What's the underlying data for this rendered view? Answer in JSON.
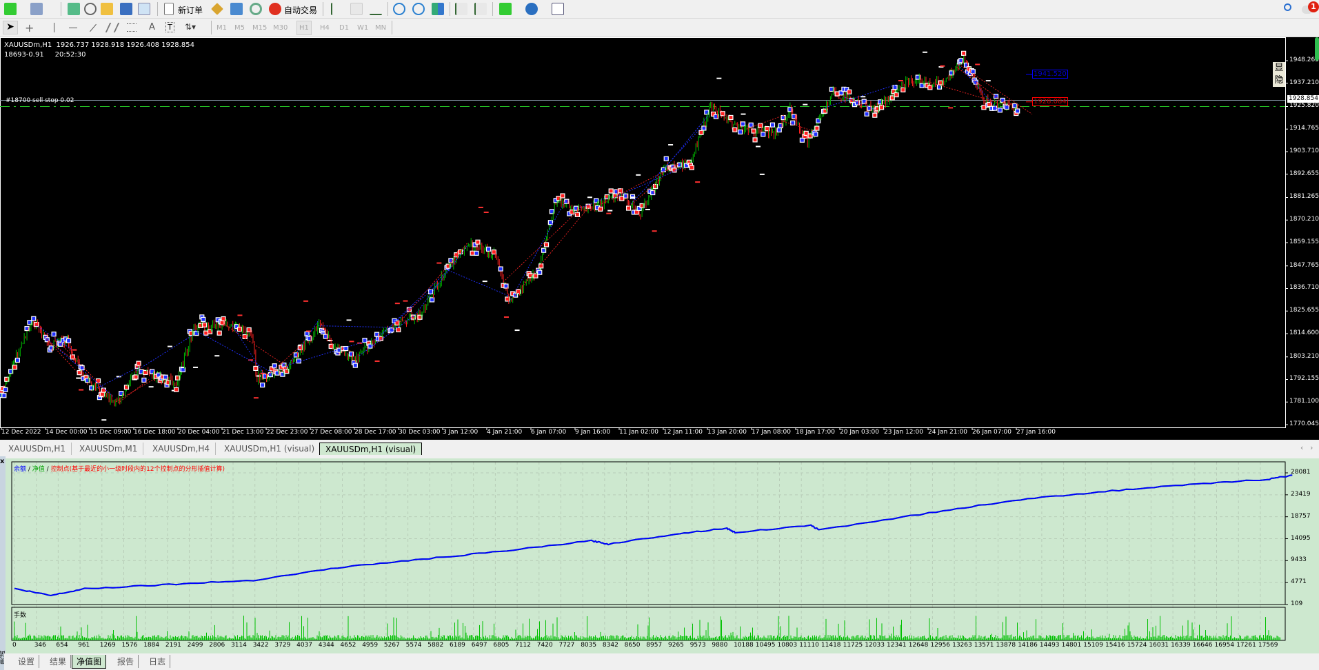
{
  "toolbar": {
    "new_order_label": "新订单",
    "auto_trading_label": "自动交易",
    "timeframes": [
      "M1",
      "M5",
      "M15",
      "M30",
      "H1",
      "H4",
      "D1",
      "W1",
      "MN"
    ],
    "active_timeframe": "H1",
    "notification_count": "1"
  },
  "chart": {
    "header_line": "XAUUSDm,H1  1926.737 1928.918 1926.408 1928.854",
    "sub_line": "18693-0.91     20:52:30",
    "order_label": "#18700 sell stop 0.02",
    "current_price": "1928.854",
    "blue_level_label": "1941.520",
    "red_level_label": "1928.084",
    "show_button": "显",
    "hide_button": "隐",
    "price_axis": [
      "1948.265",
      "1937.210",
      "1925.820",
      "1914.765",
      "1903.710",
      "1892.655",
      "1881.265",
      "1870.210",
      "1859.155",
      "1847.765",
      "1836.710",
      "1825.655",
      "1814.600",
      "1803.210",
      "1792.155",
      "1781.100",
      "1770.045"
    ],
    "time_axis": [
      "12 Dec 2022",
      "14 Dec 00:00",
      "15 Dec 09:00",
      "16 Dec 18:00",
      "20 Dec 04:00",
      "21 Dec 13:00",
      "22 Dec 23:00",
      "27 Dec 08:00",
      "28 Dec 17:00",
      "30 Dec 03:00",
      "3 Jan 12:00",
      "4 Jan 21:00",
      "6 Jan 07:00",
      "9 Jan 16:00",
      "11 Jan 02:00",
      "12 Jan 11:00",
      "13 Jan 20:00",
      "17 Jan 08:00",
      "18 Jan 17:00",
      "20 Jan 03:00",
      "23 Jan 12:00",
      "24 Jan 21:00",
      "26 Jan 07:00",
      "27 Jan 16:00"
    ],
    "price_path": [
      [
        0,
        1784.5
      ],
      [
        38,
        1821.5
      ],
      [
        60,
        1809.2
      ],
      [
        80,
        1811.2
      ],
      [
        100,
        1792.7
      ],
      [
        140,
        1780.4
      ],
      [
        160,
        1796.8
      ],
      [
        210,
        1790.6
      ],
      [
        230,
        1817.4
      ],
      [
        270,
        1819.4
      ],
      [
        300,
        1815.3
      ],
      [
        305,
        1792.7
      ],
      [
        340,
        1796.8
      ],
      [
        380,
        1819.4
      ],
      [
        395,
        1809.2
      ],
      [
        420,
        1800.9
      ],
      [
        450,
        1813.3
      ],
      [
        480,
        1821.5
      ],
      [
        500,
        1823.5
      ],
      [
        530,
        1846.2
      ],
      [
        560,
        1858.5
      ],
      [
        590,
        1852.4
      ],
      [
        605,
        1829.8
      ],
      [
        640,
        1846.2
      ],
      [
        660,
        1879.2
      ],
      [
        700,
        1875.0
      ],
      [
        740,
        1883.3
      ],
      [
        760,
        1873.0
      ],
      [
        790,
        1895.6
      ],
      [
        820,
        1897.7
      ],
      [
        845,
        1926.5
      ],
      [
        870,
        1916.2
      ],
      [
        920,
        1912.1
      ],
      [
        940,
        1924.5
      ],
      [
        960,
        1908.0
      ],
      [
        990,
        1932.7
      ],
      [
        1040,
        1924.5
      ],
      [
        1080,
        1938.9
      ],
      [
        1120,
        1936.8
      ],
      [
        1145,
        1949.1
      ],
      [
        1170,
        1928.6
      ],
      [
        1210,
        1924.5
      ]
    ]
  },
  "tabs": [
    "XAUUSDm,H1",
    "XAUUSDm,M1",
    "XAUUSDm,H4",
    "XAUUSDm,H1 (visual)",
    "XAUUSDm,H1 (visual)"
  ],
  "active_tab": 4,
  "equity": {
    "legend_balance": "余额",
    "legend_sep": " / ",
    "legend_equity": "净值",
    "legend_control": "控制点(基于最近的小一级时段内的12个控制点的分形插值计算)",
    "lots_label": "手数",
    "y_axis": [
      "28081",
      "23419",
      "18757",
      "14095",
      "9433",
      "4771",
      "109"
    ],
    "x_axis": [
      "0",
      "346",
      "654",
      "961",
      "1269",
      "1576",
      "1884",
      "2191",
      "2499",
      "2806",
      "3114",
      "3422",
      "3729",
      "4037",
      "4344",
      "4652",
      "4959",
      "5267",
      "5574",
      "5882",
      "6189",
      "6497",
      "6805",
      "7112",
      "7420",
      "7727",
      "8035",
      "8342",
      "8650",
      "8957",
      "9265",
      "9573",
      "9880",
      "10188",
      "10495",
      "10803",
      "11110",
      "11418",
      "11725",
      "12033",
      "12341",
      "12648",
      "12956",
      "13263",
      "13571",
      "13878",
      "14186",
      "14493",
      "14801",
      "15109",
      "15416",
      "15724",
      "16031",
      "16339",
      "16646",
      "16954",
      "17261",
      "17569"
    ],
    "curve": [
      [
        0,
        3477
      ],
      [
        510,
        2042
      ],
      [
        985,
        3477
      ],
      [
        2171,
        4371
      ],
      [
        3357,
        5264
      ],
      [
        4543,
        7944
      ],
      [
        5729,
        9731
      ],
      [
        6916,
        11517
      ],
      [
        8102,
        13656
      ],
      [
        8340,
        12953
      ],
      [
        9289,
        15091
      ],
      [
        10000,
        16336
      ],
      [
        10120,
        15442
      ],
      [
        11187,
        16877
      ],
      [
        11306,
        15984
      ],
      [
        12848,
        19557
      ],
      [
        14034,
        22237
      ],
      [
        15220,
        24024
      ],
      [
        16406,
        25459
      ],
      [
        17600,
        26704
      ],
      [
        17949,
        27597
      ]
    ],
    "colors": {
      "balance": "#0000ff",
      "equity": "#00a000",
      "control": "#ff0000",
      "lots": "#00c000"
    }
  },
  "side_label": "测试",
  "bottom_tabs": [
    "设置",
    "结果",
    "净值图",
    "报告",
    "日志"
  ],
  "active_bottom_tab": 2
}
